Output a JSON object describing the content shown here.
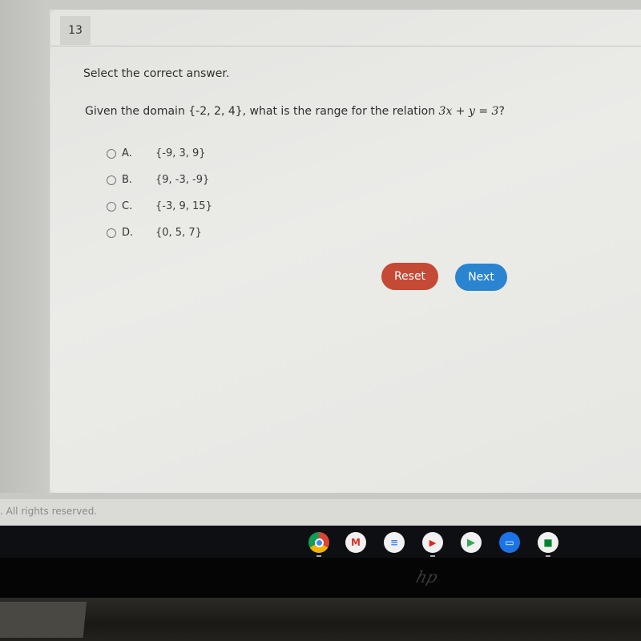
{
  "question": {
    "number": "13",
    "instruction": "Select the correct answer.",
    "text_before": "Given the domain {-2, 2, 4}, what is the range for the relation ",
    "equation": "3x + y = 3",
    "text_after": "?"
  },
  "options": [
    {
      "letter": "A.",
      "value": "{-9, 3, 9}",
      "selected": false
    },
    {
      "letter": "B.",
      "value": "{9, -3, -9}",
      "selected": false
    },
    {
      "letter": "C.",
      "value": "{-3, 9, 15}",
      "selected": false
    },
    {
      "letter": "D.",
      "value": "{0, 5, 7}",
      "selected": false
    }
  ],
  "buttons": {
    "reset_label": "Reset",
    "next_label": "Next"
  },
  "colors": {
    "reset": "#c44a36",
    "next": "#2a84cf"
  },
  "footer": {
    "text": ". All rights reserved."
  },
  "shelf": {
    "apps": [
      {
        "name": "chrome-icon",
        "glyph": "",
        "active": true
      },
      {
        "name": "gmail-icon",
        "glyph": "M",
        "active": false
      },
      {
        "name": "google-docs-icon",
        "glyph": "≡",
        "active": false
      },
      {
        "name": "youtube-icon",
        "glyph": "▶",
        "active": true
      },
      {
        "name": "play-store-icon",
        "glyph": "▶",
        "active": false
      },
      {
        "name": "messages-icon",
        "glyph": "▭",
        "active": false
      },
      {
        "name": "google-meet-icon",
        "glyph": "■",
        "active": true
      }
    ]
  },
  "device": {
    "logo": "hp"
  }
}
